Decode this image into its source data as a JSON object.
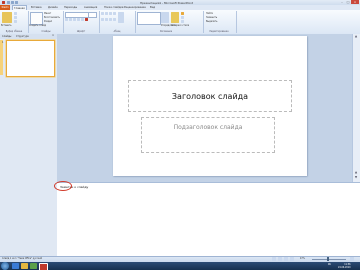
{
  "window": {
    "title": "Презентация1 - Microsoft PowerPoint"
  },
  "ribbon": {
    "file_tab": "Файл",
    "tabs": [
      "Главная",
      "Вставка",
      "Дизайн",
      "Переходы",
      "Анимация",
      "Показ слайдов",
      "Рецензирование",
      "Вид"
    ],
    "active_tab_index": 0,
    "groups": [
      "Буфер обмена",
      "Слайды",
      "Шрифт",
      "Абзац",
      "Рисование",
      "Редактирование"
    ],
    "buttons": {
      "paste": "Вставить",
      "new_slide": "Создать слайд",
      "layout": "Макет",
      "reset": "Восстановить",
      "section": "Раздел",
      "arrange": "Упорядочить",
      "quick_styles": "Экспресс-стили",
      "find": "Найти",
      "replace": "Заменить",
      "select": "Выделить"
    }
  },
  "slides_pane": {
    "tabs": [
      "Слайды",
      "Структура"
    ],
    "thumb_number": "1"
  },
  "slide": {
    "title_placeholder": "Заголовок слайда",
    "subtitle_placeholder": "Подзаголовок слайда"
  },
  "notes": {
    "placeholder": "Заметки к слайду"
  },
  "status": {
    "left": "Слайд 1 из 1   \"Тема Office\"   русский",
    "zoom": "47%"
  },
  "taskbar": {
    "time": "11:56",
    "date": "24.06.2010",
    "lang": "RU"
  },
  "colors": {
    "file_tab": "#d55b1a",
    "notes_annotation": "#d23b2b",
    "canvas_bg": "#c3d2e6"
  }
}
